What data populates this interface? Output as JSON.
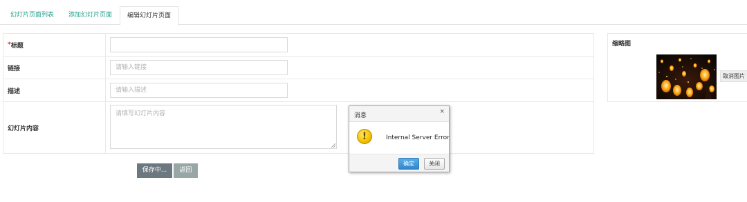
{
  "tabs": [
    {
      "label": "幻灯片页面列表"
    },
    {
      "label": "添加幻灯片页面"
    },
    {
      "label": "编辑幻灯片页面"
    }
  ],
  "form": {
    "title": {
      "required_mark": "*",
      "label": "标题",
      "value": "",
      "placeholder": ""
    },
    "link": {
      "label": "链接",
      "value": "",
      "placeholder": "请输入链接"
    },
    "description": {
      "label": "描述",
      "value": "",
      "placeholder": "请输入描述"
    },
    "content": {
      "label": "幻灯片内容",
      "value": "",
      "placeholder": "请填写幻灯片内容"
    }
  },
  "thumbnail": {
    "heading": "缩略图",
    "cancel_label": "取消图片"
  },
  "actions": {
    "save_label": "保存中...",
    "back_label": "返回"
  },
  "dialog": {
    "title": "消息",
    "close_glyph": "×",
    "icon_glyph": "!",
    "message": "Internal Server Error",
    "ok_label": "确定",
    "close_label": "关闭"
  },
  "colors": {
    "tab_link": "#20a08a",
    "required": "#d9251c",
    "save_button": "#6c7880",
    "back_button": "#99a6a6",
    "ok_button": "#2f86cc",
    "warning": "#f5c400"
  }
}
